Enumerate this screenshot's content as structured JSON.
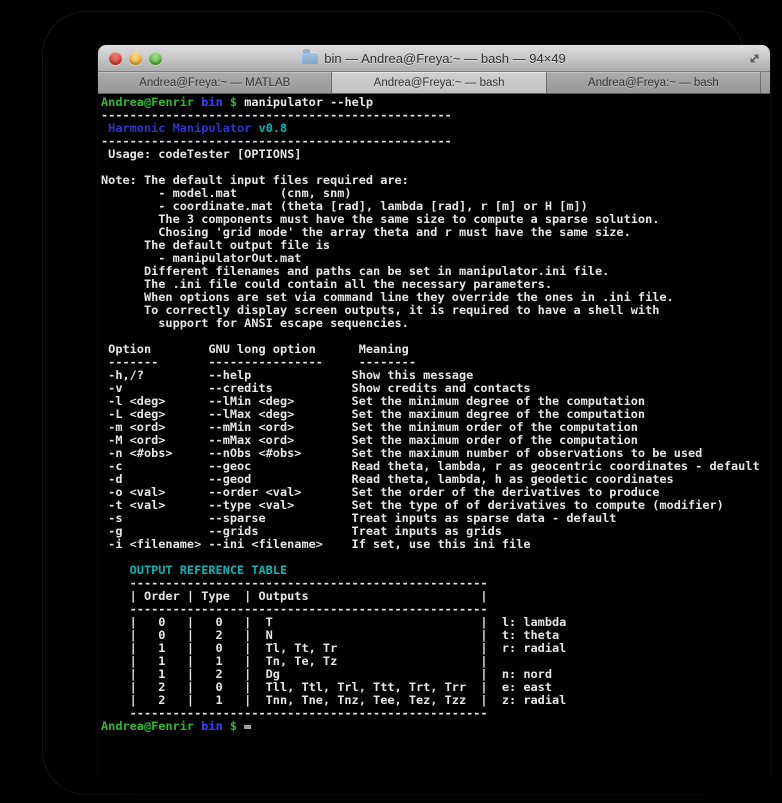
{
  "window": {
    "title": "bin — Andrea@Freya:~ — bash — 94×49",
    "controls": {
      "close": "close",
      "minimize": "minimize",
      "zoom": "zoom"
    },
    "tabs": [
      {
        "label": "Andrea@Freya:~ — MATLAB",
        "active": false
      },
      {
        "label": "Andrea@Freya:~ — bash",
        "active": true
      },
      {
        "label": "Andrea@Freya:~ — bash",
        "active": false
      }
    ],
    "icons": {
      "folder": "folder-icon",
      "fullscreen": "fullscreen-arrow-icon"
    }
  },
  "palette": {
    "fg": "#e6e6e6",
    "green": "#2eb82e",
    "blue": "#3b3bff",
    "navy": "#3232cd",
    "cyan": "#00b8b8",
    "cursor": "#9e9e9e",
    "background": "#000000"
  },
  "terminal": {
    "prompt": {
      "user_host": "Andrea@Fenrir",
      "dir": "bin",
      "symbol": "$"
    },
    "command": "manipulator --help",
    "lines": [
      [
        [
          "green",
          "Andrea@Fenrir"
        ],
        [
          "fg",
          " "
        ],
        [
          "blue",
          "bin"
        ],
        [
          "fg",
          " "
        ],
        [
          "green",
          "$"
        ],
        [
          "fg",
          " manipulator --help"
        ]
      ],
      "-------------------------------------------------",
      [
        [
          "fg",
          " "
        ],
        [
          "navy",
          "Harmonic Manipulator"
        ],
        [
          "fg",
          " "
        ],
        [
          "cyan",
          "v0.8"
        ]
      ],
      "-------------------------------------------------",
      " Usage: codeTester [OPTIONS]",
      "",
      "Note: The default input files required are:",
      "        - model.mat      (cnm, snm)",
      "        - coordinate.mat (theta [rad], lambda [rad], r [m] or H [m])",
      "        The 3 components must have the same size to compute a sparse solution.",
      "        Chosing 'grid mode' the array theta and r must have the same size.",
      "      The default output file is",
      "        - manipulatorOut.mat",
      "      Different filenames and paths can be set in manipulator.ini file.",
      "      The .ini file could contain all the necessary parameters.",
      "      When options are set via command line they override the ones in .ini file.",
      "      To correctly display screen outputs, it is required to have a shell with",
      "        support for ANSI escape sequencies.",
      "",
      " Option        GNU long option      Meaning",
      " -------       ----------------     --------",
      " -h,/?         --help              Show this message",
      " -v            --credits           Show credits and contacts",
      " -l <deg>      --lMin <deg>        Set the minimum degree of the computation",
      " -L <deg>      --lMax <deg>        Set the maximum degree of the computation",
      " -m <ord>      --mMin <ord>        Set the minimum order of the computation",
      " -M <ord>      --mMax <ord>        Set the maximum order of the computation",
      " -n <#obs>     --nObs <#obs>       Set the maximum number of observations to be used",
      " -c            --geoc              Read theta, lambda, r as geocentric coordinates - default",
      " -d            --geod              Read theta, lambda, h as geodetic coordinates",
      " -o <val>      --order <val>       Set the order of the derivatives to produce",
      " -t <val>      --type <val>        Set the type of of derivatives to compute (modifier)",
      " -s            --sparse            Treat inputs as sparse data - default",
      " -g            --grids             Treat inputs as grids",
      " -i <filename> --ini <filename>    If set, use this ini file",
      "",
      [
        [
          "fg",
          "    "
        ],
        [
          "cyan",
          "OUTPUT REFERENCE TABLE"
        ]
      ],
      "    --------------------------------------------------",
      "    | Order | Type  | Outputs                        |",
      "    --------------------------------------------------",
      "    |   0   |   0   |  T                             |  l: lambda",
      "    |   0   |   2   |  N                             |  t: theta",
      "    |   1   |   0   |  Tl, Tt, Tr                    |  r: radial",
      "    |   1   |   1   |  Tn, Te, Tz                    |",
      "    |   1   |   2   |  Dg                            |  n: nord",
      "    |   2   |   0   |  Tll, Ttl, Trl, Ttt, Trt, Trr  |  e: east",
      "    |   2   |   1   |  Tnn, Tne, Tnz, Tee, Tez, Tzz  |  z: radial",
      "    --------------------------------------------------",
      [
        [
          "green",
          "Andrea@Fenrir"
        ],
        [
          "fg",
          " "
        ],
        [
          "blue",
          "bin"
        ],
        [
          "fg",
          " "
        ],
        [
          "green",
          "$"
        ],
        [
          "fg",
          " "
        ],
        [
          "cursor",
          ""
        ]
      ]
    ]
  }
}
